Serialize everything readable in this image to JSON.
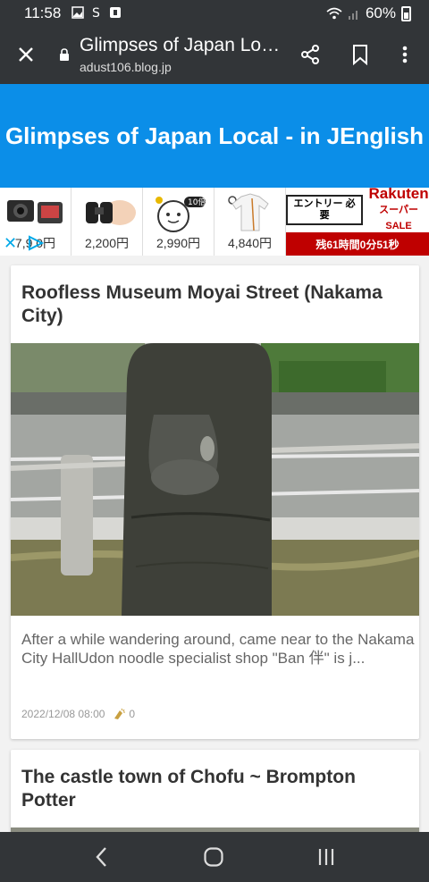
{
  "status": {
    "time": "11:58",
    "battery": "60%"
  },
  "browser": {
    "page_title": "Glimpses of Japan Loc...",
    "host": "adust106.blog.jp"
  },
  "blog": {
    "title": "Glimpses of Japan Local - in JEnglish"
  },
  "ads": {
    "items": [
      {
        "price": "7,9 0円",
        "icon": "camera"
      },
      {
        "price": "2,200円",
        "icon": "binoculars"
      },
      {
        "price": "2,990円",
        "icon": "badge-10x"
      },
      {
        "price": "4,840円",
        "icon": "shirt"
      }
    ],
    "rakuten": {
      "entry": "エントリー 必要",
      "brand": "Rakuten",
      "sale": "スーパーSALE",
      "countdown": "残61時間0分51秒"
    },
    "badge_text": "10倍"
  },
  "posts": [
    {
      "title": "Roofless Museum Moyai Street (Nakama City)",
      "excerpt": "After a while wandering around, came near to the Nakama City HallUdon noodle specialist shop \"Ban 伴\" is j...",
      "date": "2022/12/08 08:00",
      "likes": "0"
    },
    {
      "title": "The castle town of Chofu ~ Brompton Potter"
    }
  ],
  "colors": {
    "header_blue": "#0b8ee8",
    "chrome_dark": "#323538",
    "rakuten_red": "#bf0000"
  }
}
